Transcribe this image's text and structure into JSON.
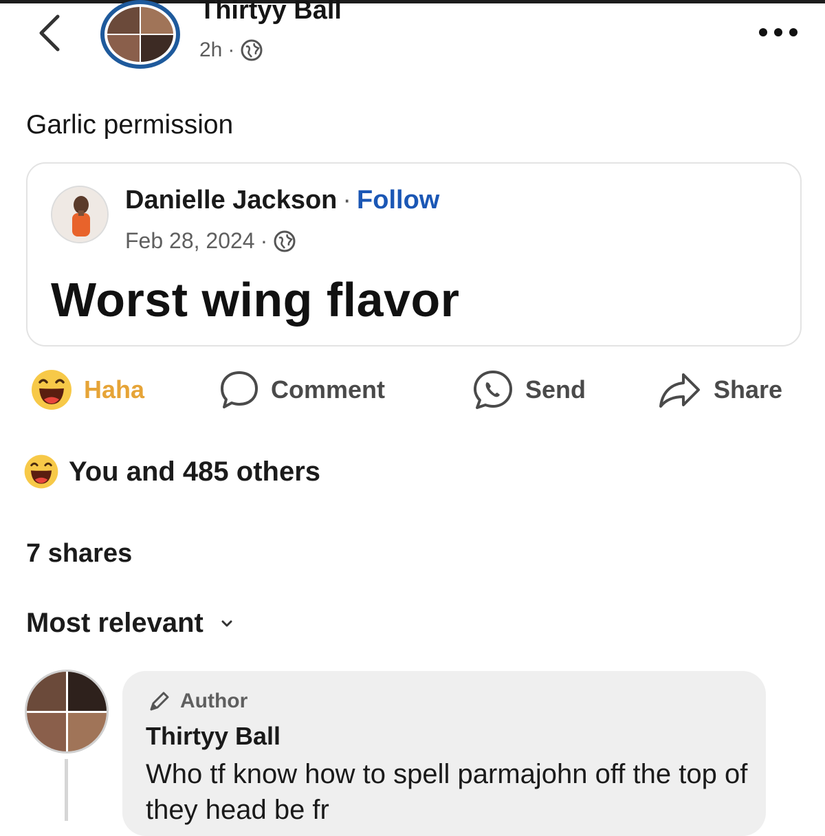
{
  "post": {
    "author": "Thirtyy Ball",
    "time": "2h",
    "separator": "·",
    "caption": "Garlic permission"
  },
  "shared_post": {
    "author": "Danielle Jackson",
    "separator": "·",
    "follow_label": "Follow",
    "date": "Feb 28, 2024",
    "text": "Worst wing flavor"
  },
  "actions": {
    "haha": "Haha",
    "comment": "Comment",
    "send": "Send",
    "share": "Share"
  },
  "reactions_summary": "You and 485 others",
  "shares_count": "7 shares",
  "sort_label": "Most relevant",
  "comment": {
    "badge": "Author",
    "author": "Thirtyy Ball",
    "text": "Who tf know how to spell parmajohn off the top of they head be fr"
  },
  "colors": {
    "follow": "#1b57b5",
    "haha": "#e6a437",
    "avatar_ring": "#1e5a9c",
    "bubble": "#efefef"
  },
  "icons": [
    "back-chevron-icon",
    "globe-icon",
    "more-options-icon",
    "haha-emoji-icon",
    "comment-icon",
    "send-messenger-icon",
    "share-arrow-icon",
    "chevron-down-icon",
    "pencil-icon"
  ]
}
